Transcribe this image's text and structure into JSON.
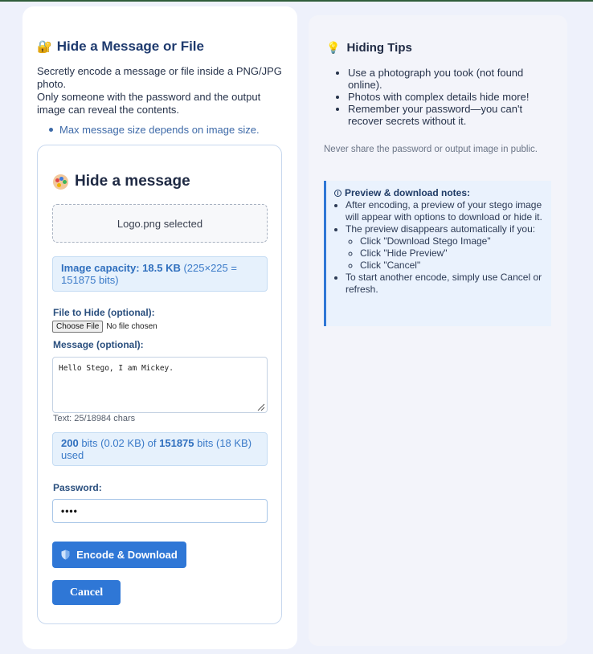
{
  "left": {
    "title": "Hide a Message or File",
    "desc_line1": "Secretly encode a message or file inside a PNG/JPG photo.",
    "desc_line2": "Only someone with the password and the output image can reveal the contents.",
    "max_note": "Max message size depends on image size.",
    "lock_icon": "🔐"
  },
  "form": {
    "title": "Hide a message",
    "file_selected": "Logo.png selected",
    "capacity_label": "Image capacity: 18.5 KB",
    "capacity_detail": " (225×225 = 151875 bits)",
    "file_label": "File to Hide (optional):",
    "choose_file_label": "Choose File",
    "no_file_text": "No file chosen",
    "message_label": "Message (optional):",
    "message_value": "Hello Stego, I am Mickey.",
    "char_count": "Text: 25/18984 chars",
    "bits_used": "200",
    "bits_used_kb": " bits (0.02 KB) of ",
    "bits_total": "151875",
    "bits_total_kb": " bits (18 KB) used",
    "password_label": "Password:",
    "password_value": "••••",
    "encode_button": "Encode & Download",
    "cancel_button": "Cancel"
  },
  "tips": {
    "title": "Hiding Tips",
    "bulb_icon": "💡",
    "items": [
      "Use a photograph you took (not found online).",
      "Photos with complex details hide more!",
      "Remember your password—you can't recover secrets without it."
    ],
    "warning": "Never share the password or output image in public.",
    "notes_title": "Preview & download notes:",
    "notes": [
      "After encoding, a preview of your stego image will appear with options to download or hide it.",
      "The preview disappears automatically if you:",
      "To start another encode, simply use Cancel or refresh."
    ],
    "sub_notes": [
      "Click \"Download Stego Image\"",
      "Click \"Hide Preview\"",
      "Click \"Cancel\""
    ]
  }
}
